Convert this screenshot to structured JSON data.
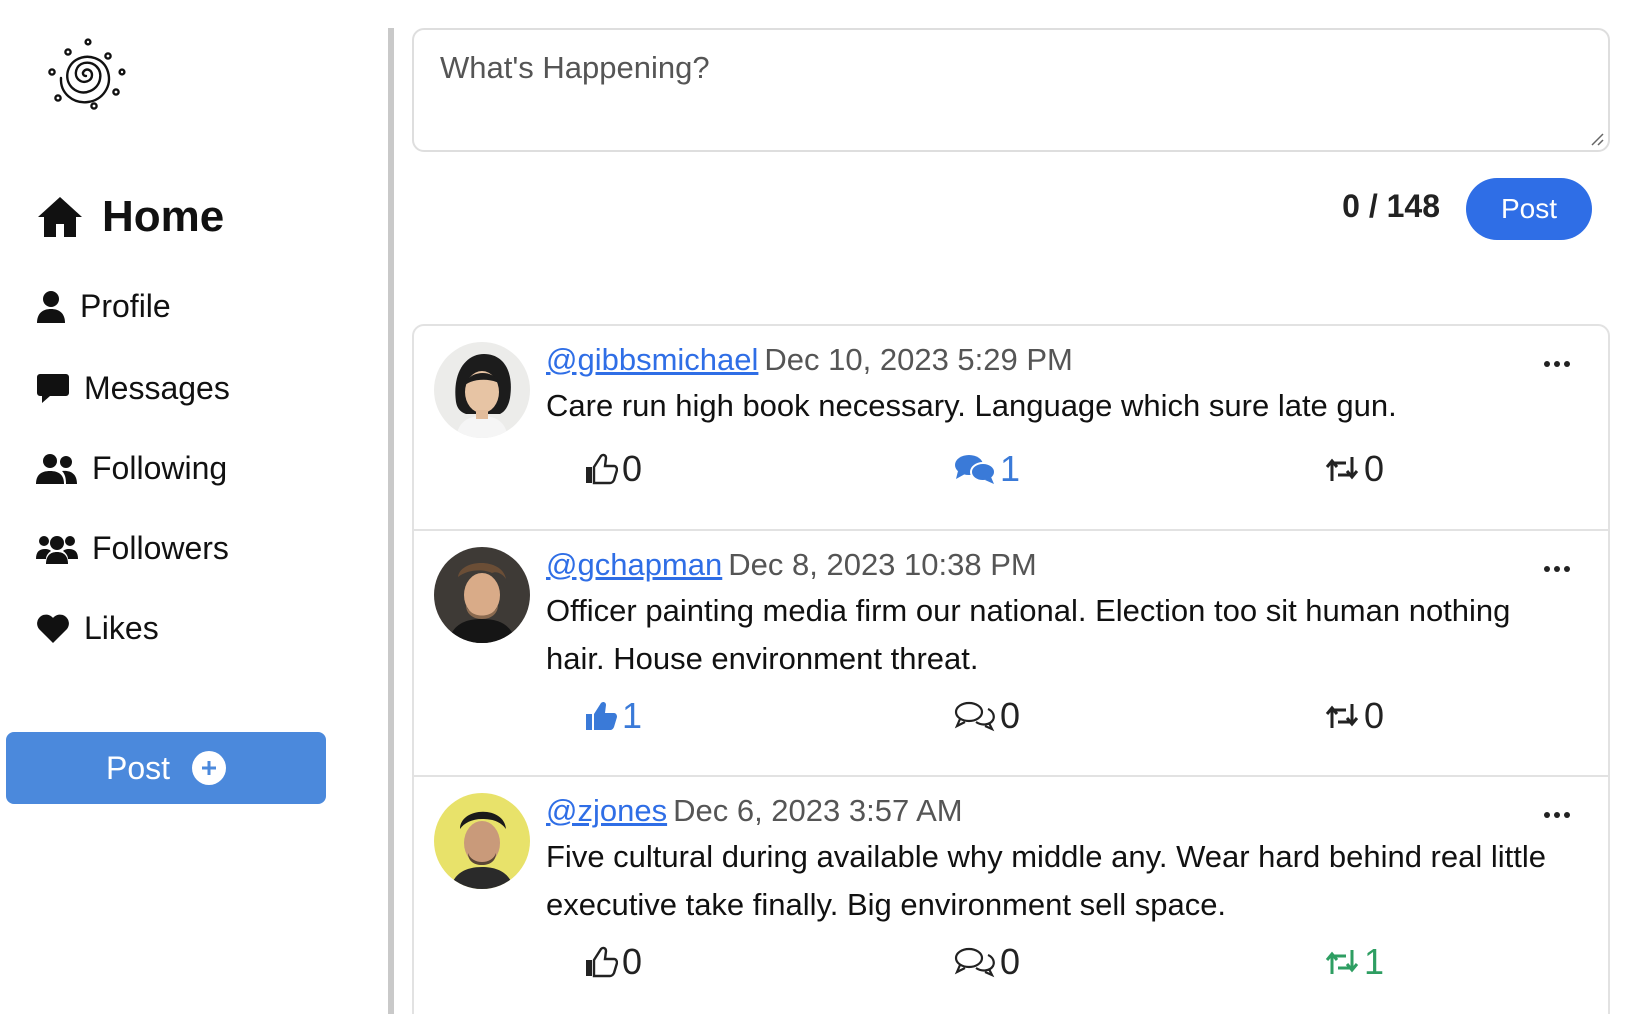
{
  "sidebar": {
    "logo_icon": "spiral-galaxy-logo",
    "nav": [
      {
        "label": "Home",
        "icon": "house-icon"
      },
      {
        "label": "Profile",
        "icon": "person-icon"
      },
      {
        "label": "Messages",
        "icon": "chat-bubble-icon"
      },
      {
        "label": "Following",
        "icon": "user-group-icon"
      },
      {
        "label": "Followers",
        "icon": "users-icon"
      },
      {
        "label": "Likes",
        "icon": "heart-icon"
      }
    ],
    "post_button": {
      "label": "Post",
      "icon": "plus-circle-icon"
    }
  },
  "composer": {
    "placeholder": "What's Happening?",
    "value": "",
    "char_count": "0 / 148",
    "post_label": "Post"
  },
  "feed": {
    "posts": [
      {
        "handle": "@gibbsmichael",
        "timestamp": "Dec 10, 2023 5:29 PM",
        "body": "Care run high book necessary. Language which sure late gun.",
        "likes": "0",
        "comments": "1",
        "reposts": "0",
        "liked": false,
        "commented": true,
        "reposted": false
      },
      {
        "handle": "@gchapman",
        "timestamp": "Dec 8, 2023 10:38 PM",
        "body": "Officer painting media firm our national. Election too sit human nothing hair. House environment threat.",
        "likes": "1",
        "comments": "0",
        "reposts": "0",
        "liked": true,
        "commented": false,
        "reposted": false
      },
      {
        "handle": "@zjones",
        "timestamp": "Dec 6, 2023 3:57 AM",
        "body": "Five cultural during available why middle any. Wear hard behind real little executive take finally. Big environment sell space.",
        "likes": "0",
        "comments": "0",
        "reposts": "1",
        "liked": false,
        "commented": false,
        "reposted": true
      }
    ]
  },
  "colors": {
    "accent_blue": "#2f6ee6",
    "sidebar_post_blue": "#4b89dc",
    "active_blue": "#3a7ad8",
    "repost_green": "#2e9e62"
  }
}
